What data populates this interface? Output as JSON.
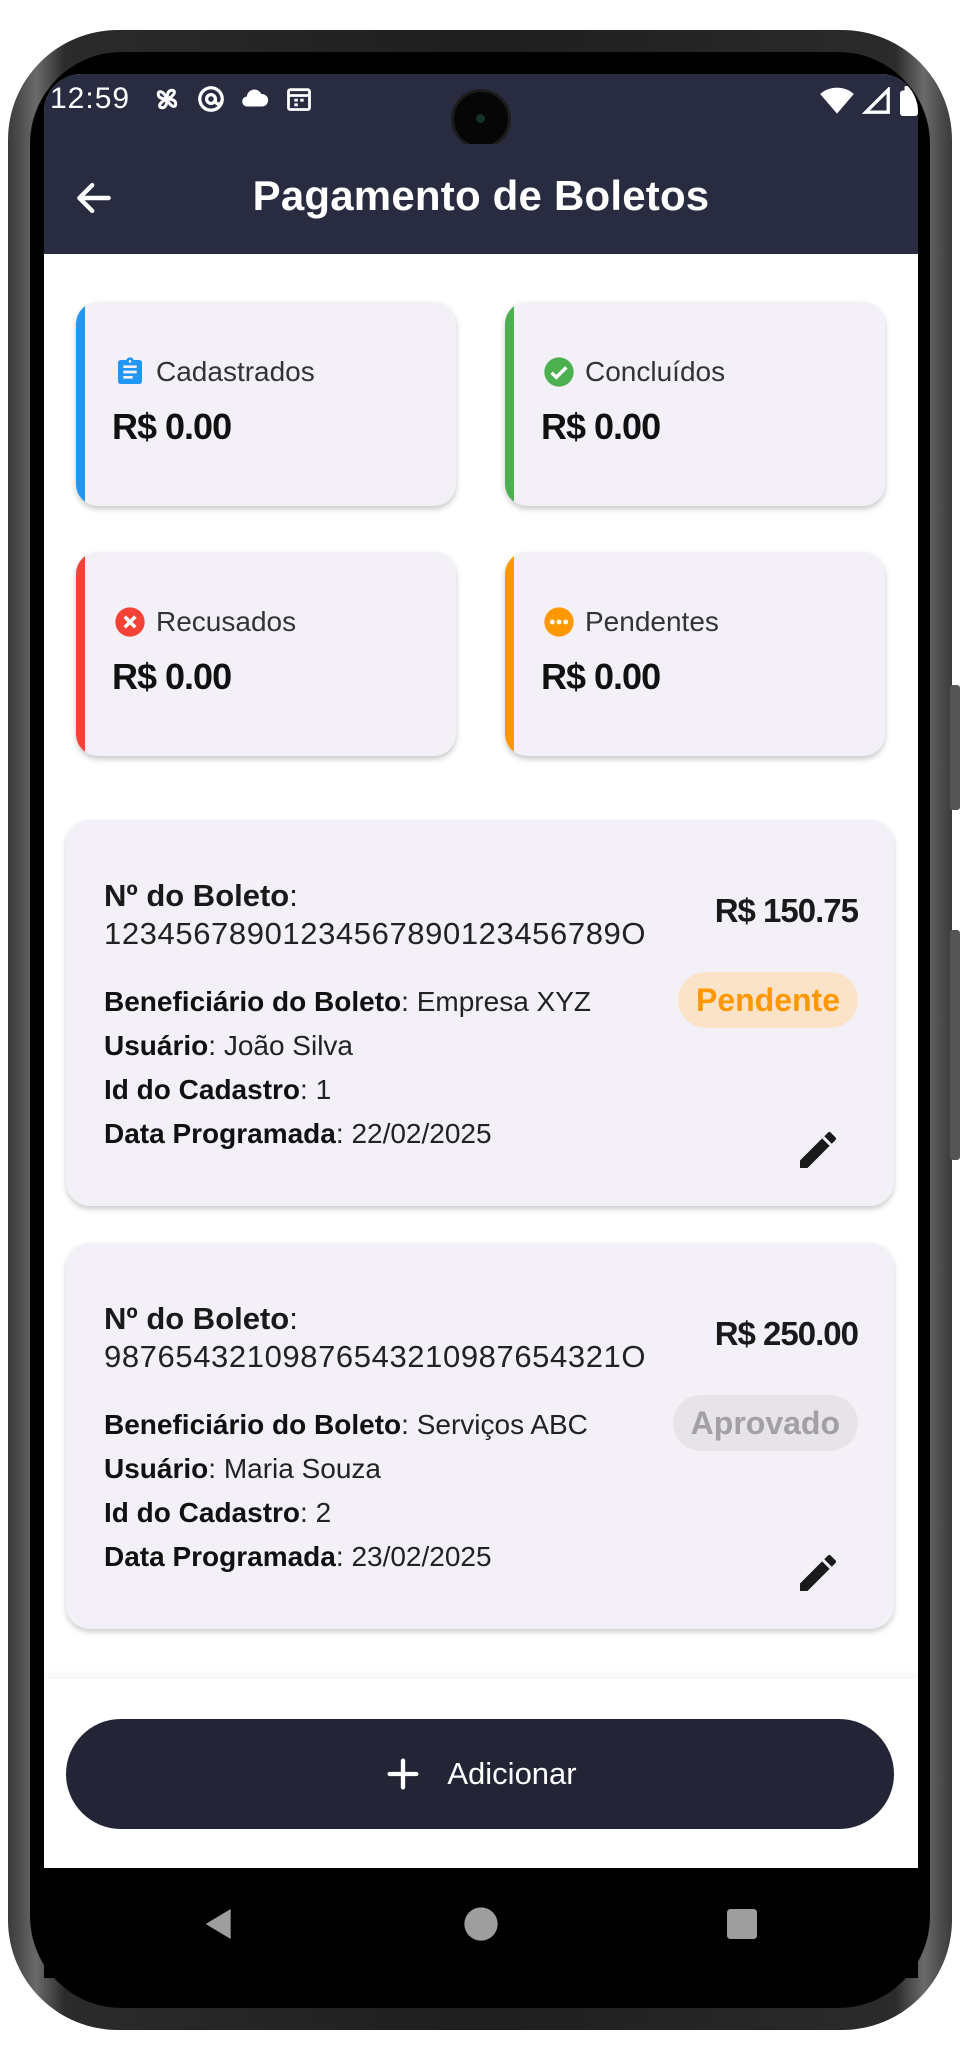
{
  "statusbar": {
    "time": "12:59",
    "left_icons": [
      "fan-icon",
      "at-sign-icon",
      "cloud-icon",
      "calendar-icon"
    ],
    "right_icons": [
      "wifi-icon",
      "signal-icon",
      "battery-icon"
    ]
  },
  "appbar": {
    "title": "Pagamento de Boletos",
    "back_icon": "arrow-back-icon"
  },
  "summary": [
    {
      "label": "Cadastrados",
      "value": "R$ 0.00",
      "color": "#2196f3",
      "icon": "clipboard-icon"
    },
    {
      "label": "Concluídos",
      "value": "R$ 0.00",
      "color": "#4caf50",
      "icon": "check-circle-icon"
    },
    {
      "label": "Recusados",
      "value": "R$ 0.00",
      "color": "#f44336",
      "icon": "cancel-circle-icon"
    },
    {
      "label": "Pendentes",
      "value": "R$ 0.00",
      "color": "#ff9800",
      "icon": "more-circle-icon"
    }
  ],
  "labels": {
    "numero": "Nº do Boleto",
    "beneficiario": "Beneficiário do Boleto",
    "usuario": "Usuário",
    "id_cadastro": "Id do Cadastro",
    "data_programada": "Data Programada",
    "colon": ": "
  },
  "boletos": [
    {
      "numero": "12345678901234567890123456789O",
      "amount": "R$ 150.75",
      "beneficiario": "Empresa XYZ",
      "usuario": "João Silva",
      "id_cadastro": "1",
      "data_programada": "22/02/2025",
      "status": "Pendente",
      "status_color": "#ff9800",
      "status_bg": "#fbe3c9"
    },
    {
      "numero": "98765432109876543210987654321O",
      "amount": "R$ 250.00",
      "beneficiario": "Serviços ABC",
      "usuario": "Maria Souza",
      "id_cadastro": "2",
      "data_programada": "23/02/2025",
      "status": "Aprovado",
      "status_color": "#a2a0a6",
      "status_bg": "#e6e3e9"
    }
  ],
  "add_button": {
    "label": "Adicionar",
    "icon": "plus-icon"
  },
  "navbar": {
    "icons": [
      "nav-back-icon",
      "nav-home-icon",
      "nav-recents-icon"
    ]
  },
  "colors": {
    "appbar": "#292b40",
    "button": "#232536",
    "card": "#f4f0f7"
  }
}
